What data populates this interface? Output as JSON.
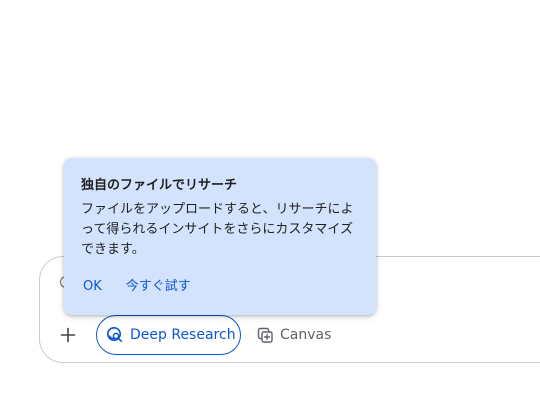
{
  "popover": {
    "title": "独自のファイルでリサーチ",
    "body": "ファイルをアップロードすると、リサーチによって得られるインサイトをさらにカスタマイズできます。",
    "actions": {
      "ok": "OK",
      "try_now": "今すぐ試す"
    }
  },
  "toolbar": {
    "add_icon": "plus-icon",
    "deep_research": {
      "label": "Deep Research",
      "icon": "deep-research-icon",
      "selected": true
    },
    "canvas": {
      "label": "Canvas",
      "icon": "canvas-icon"
    }
  },
  "colors": {
    "accent": "#0b57d0",
    "popover_bg": "#d3e3fd",
    "muted_text": "#5f6368",
    "border": "#c9ccd1"
  }
}
